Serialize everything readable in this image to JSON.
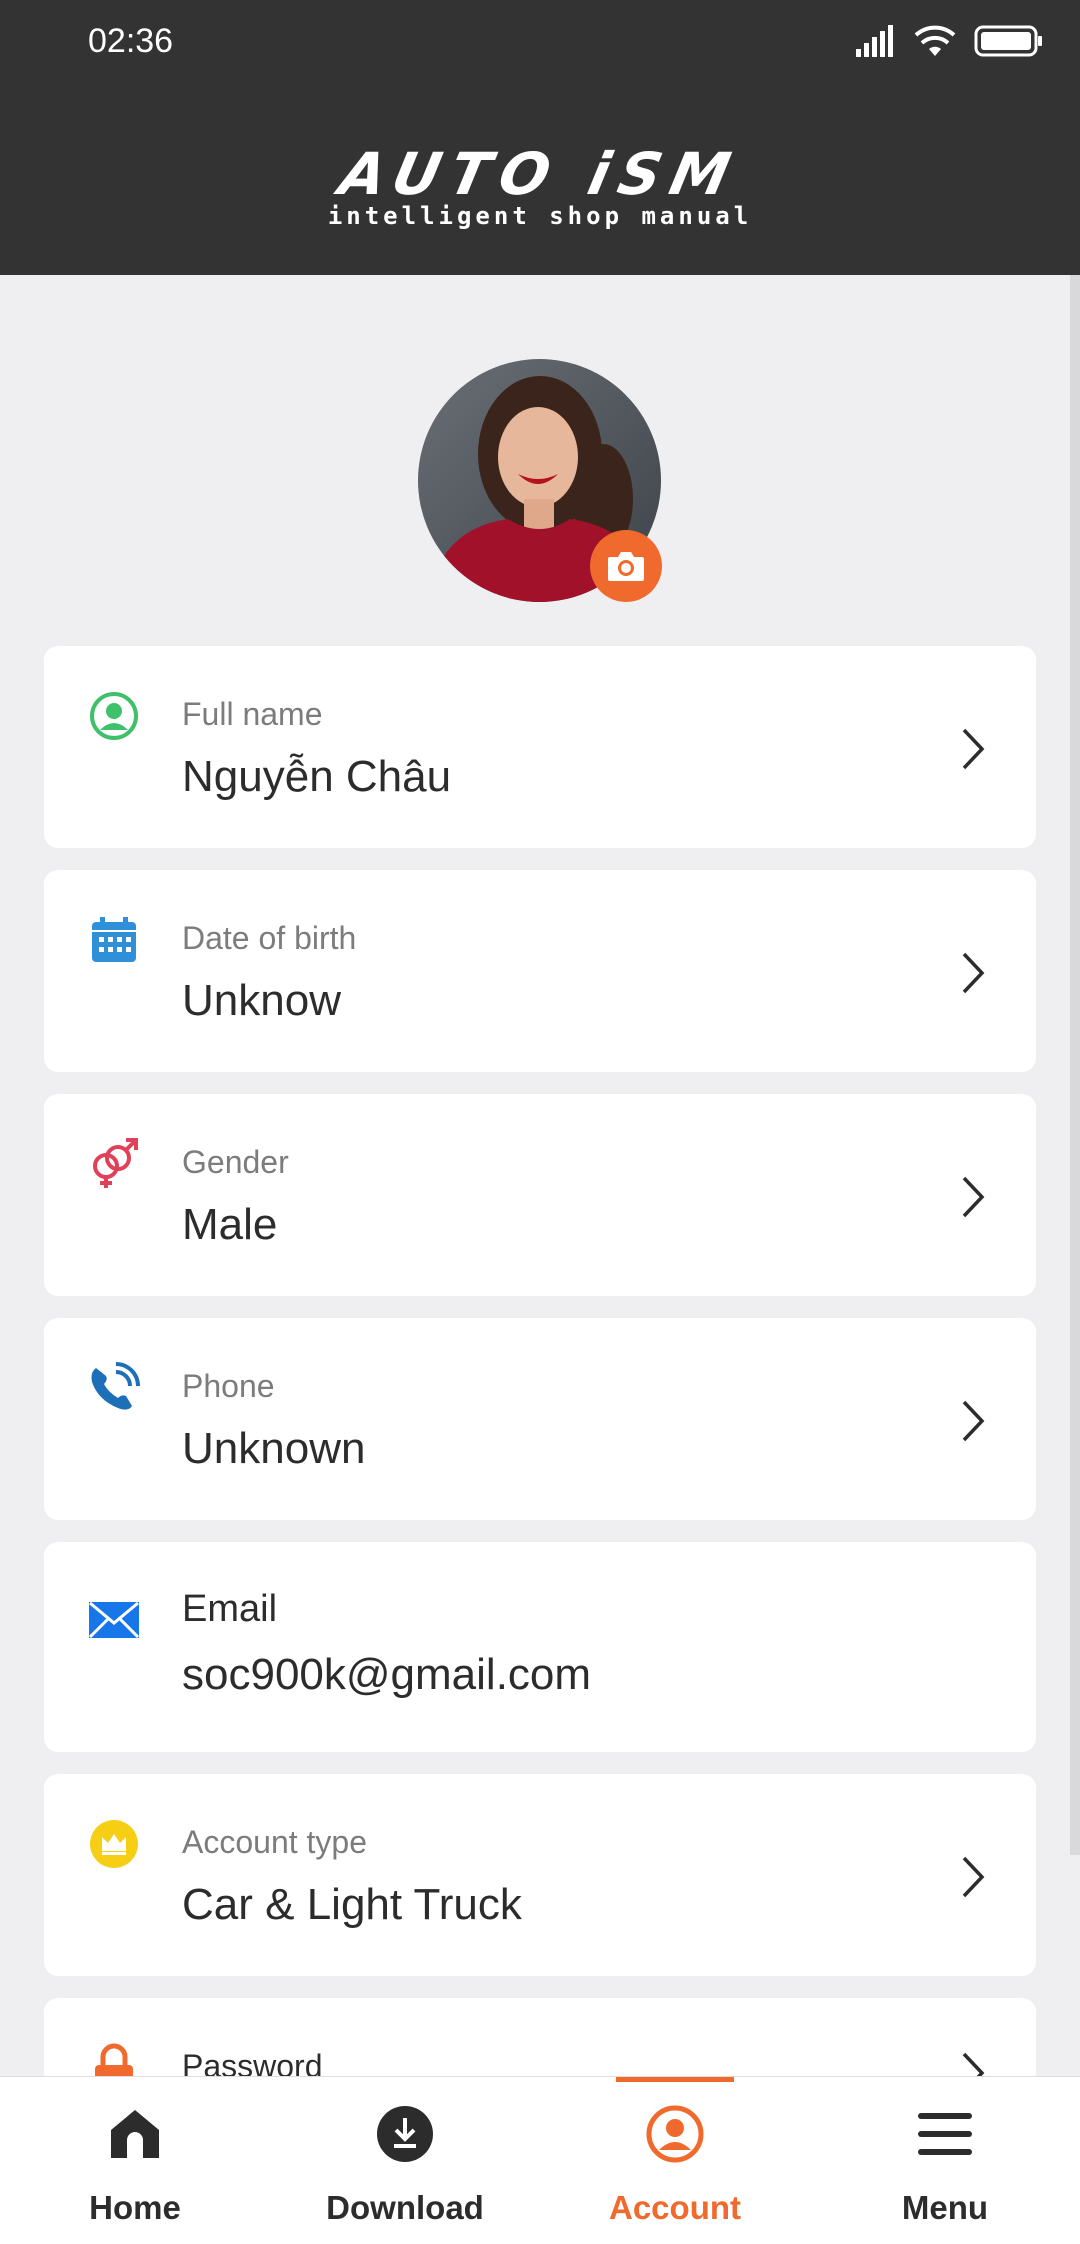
{
  "status_bar": {
    "time": "02:36"
  },
  "header": {
    "logo_main": "AUTO iSM",
    "logo_sub": "intelligent shop manual"
  },
  "colors": {
    "accent": "#ef6a2c",
    "header_bg": "#333333",
    "page_bg": "#efeff1"
  },
  "profile_fields": [
    {
      "label": "Full name",
      "value": "Nguyễn Châu",
      "icon": "person-circle-icon"
    },
    {
      "label": "Date of birth",
      "value": "Unknow",
      "icon": "calendar-icon"
    },
    {
      "label": "Gender",
      "value": "Male",
      "icon": "gender-icon"
    },
    {
      "label": "Phone",
      "value": "Unknown",
      "icon": "phone-icon"
    },
    {
      "label": "Email",
      "value": "soc900k@gmail.com",
      "icon": "envelope-icon"
    },
    {
      "label": "Account type",
      "value": "Car & Light Truck",
      "icon": "crown-icon"
    },
    {
      "label": "Password",
      "value": "",
      "icon": "lock-icon"
    }
  ],
  "bottom_nav": {
    "items": [
      {
        "label": "Home",
        "icon": "home-icon"
      },
      {
        "label": "Download",
        "icon": "download-icon"
      },
      {
        "label": "Account",
        "icon": "account-icon",
        "active": true
      },
      {
        "label": "Menu",
        "icon": "menu-icon"
      }
    ]
  }
}
